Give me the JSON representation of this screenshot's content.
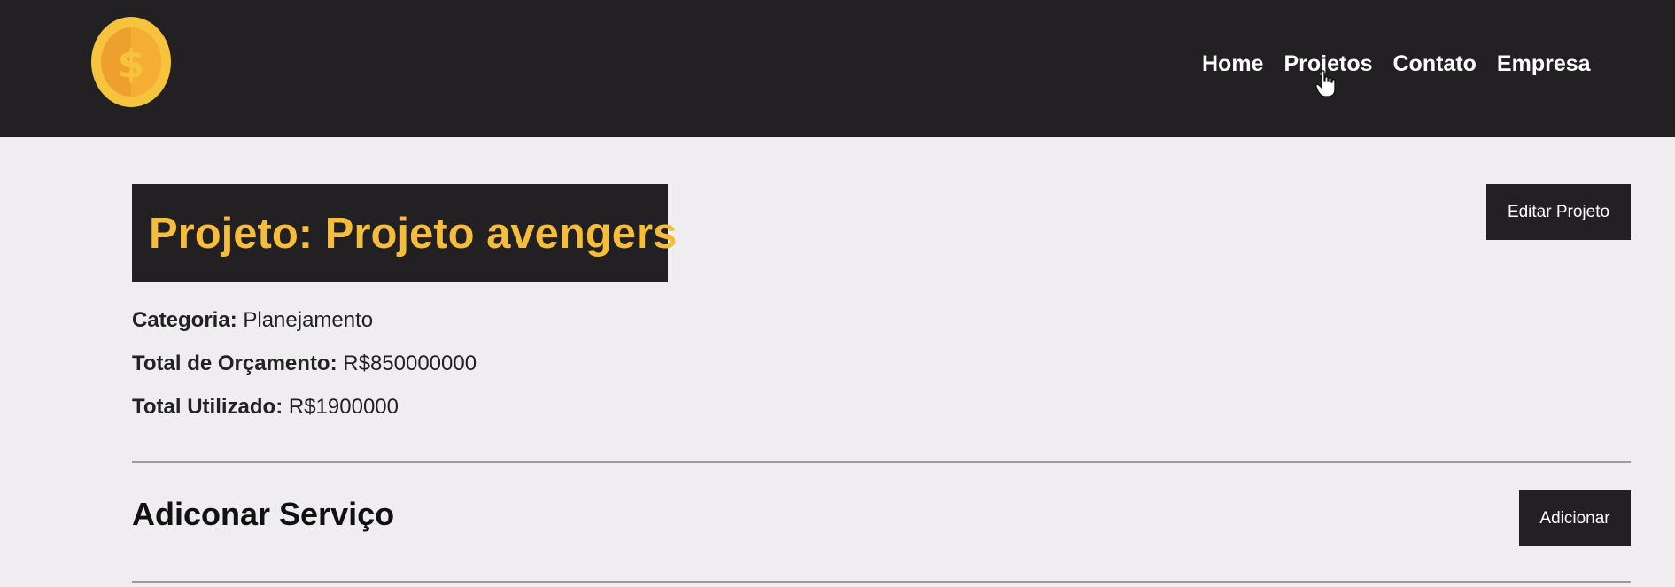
{
  "navbar": {
    "logo_icon": "coin-dollar-icon",
    "links": [
      {
        "label": "Home"
      },
      {
        "label": "Projetos"
      },
      {
        "label": "Contato"
      },
      {
        "label": "Empresa"
      }
    ]
  },
  "project": {
    "title": "Projeto: Projeto avengers",
    "edit_label": "Editar Projeto",
    "category_label": "Categoria:",
    "category_value": "Planejamento",
    "budget_label": "Total de Orçamento:",
    "budget_value": "R$850000000",
    "used_label": "Total Utilizado:",
    "used_value": "R$1900000"
  },
  "service": {
    "section_title": "Adiconar Serviço",
    "add_label": "Adicionar"
  },
  "colors": {
    "navbar_bg": "#222022",
    "page_bg": "#efedf0",
    "accent": "#f6bd3a",
    "coin_outer": "#f6c33d",
    "coin_inner": "#eea02f"
  }
}
